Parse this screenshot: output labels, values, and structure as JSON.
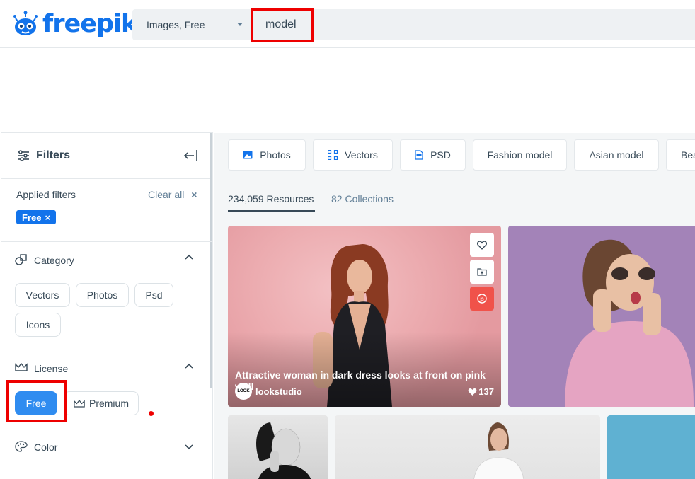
{
  "header": {
    "logo_text": "freepik",
    "search_type": "Images, Free",
    "search_query": "model"
  },
  "filters": {
    "title": "Filters",
    "applied_label": "Applied filters",
    "clear_all": "Clear all",
    "applied_chip": "Free",
    "category": {
      "title": "Category",
      "options": [
        "Vectors",
        "Photos",
        "Psd",
        "Icons"
      ]
    },
    "license": {
      "title": "License",
      "options": [
        "Free",
        "Premium"
      ],
      "selected": "Free"
    },
    "color": {
      "title": "Color"
    }
  },
  "tags": [
    "Photos",
    "Vectors",
    "PSD",
    "Fashion model",
    "Asian model",
    "Bea"
  ],
  "tabs": {
    "resources": "234,059 Resources",
    "collections": "82 Collections"
  },
  "card": {
    "title": "Attractive woman in dark dress looks at front on pink wall",
    "author": "lookstudio",
    "avatar_text": "LOOK",
    "likes": "137"
  },
  "colors": {
    "brand": "#1273eb",
    "highlight": "#ee0000",
    "pinterest": "#f0524a"
  }
}
